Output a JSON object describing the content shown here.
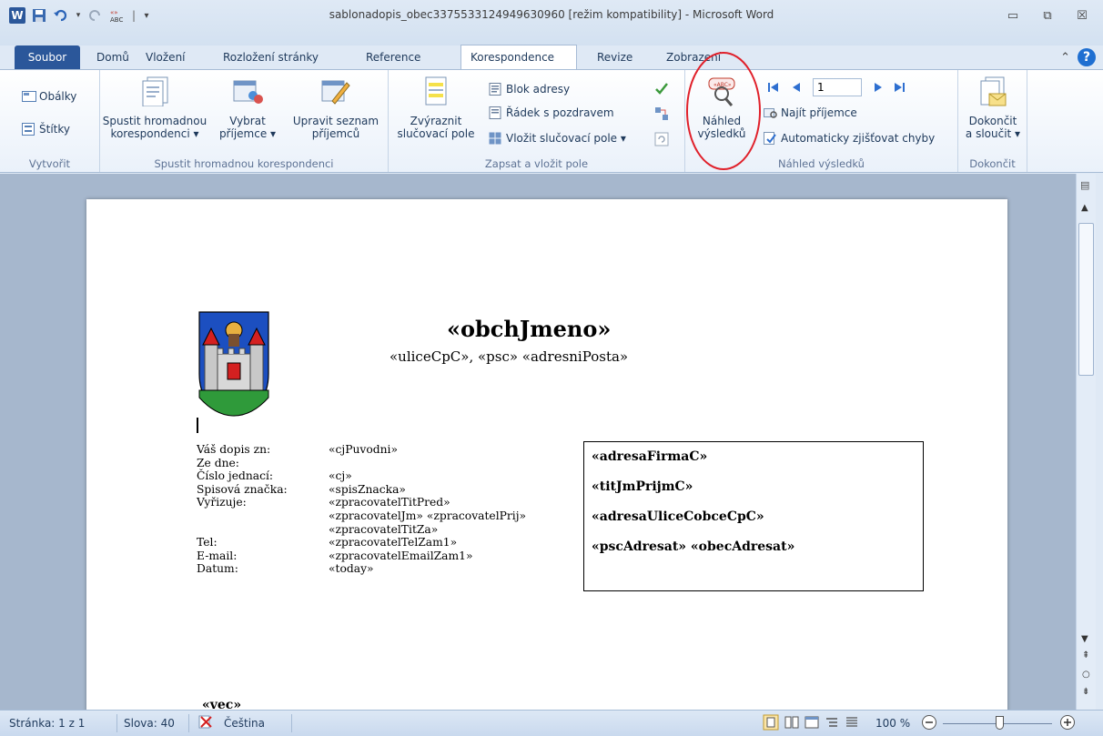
{
  "window": {
    "title": "sablonadopis_obec3375533124949630960 [režim kompatibility] - Microsoft Word"
  },
  "qat": {
    "word_logo": "W",
    "separator": "|"
  },
  "tabs": [
    {
      "label": "Soubor"
    },
    {
      "label": "Domů"
    },
    {
      "label": "Vložení"
    },
    {
      "label": "Rozložení stránky"
    },
    {
      "label": "Reference"
    },
    {
      "label": "Korespondence",
      "active": true
    },
    {
      "label": "Revize"
    },
    {
      "label": "Zobrazení"
    }
  ],
  "ribbon": {
    "create": {
      "label": "Vytvořit",
      "envelopes": "Obálky",
      "labels": "Štítky"
    },
    "start_merge": {
      "label": "Spustit hromadnou korespondenci",
      "start_line1": "Spustit hromadnou",
      "start_line2": "korespondenci ▾",
      "select_line1": "Vybrat",
      "select_line2": "příjemce ▾",
      "edit_line1": "Upravit seznam",
      "edit_line2": "příjemců"
    },
    "write_insert": {
      "label": "Zapsat a vložit pole",
      "highlight_line1": "Zvýraznit",
      "highlight_line2": "slučovací pole",
      "address_block": "Blok adresy",
      "greeting_line": "Řádek s pozdravem",
      "insert_field": "Vložit slučovací pole ▾"
    },
    "preview": {
      "label": "Náhled výsledků",
      "preview_line1": "Náhled",
      "preview_line2": "výsledků",
      "record_number": "1",
      "find_recipient": "Najít příjemce",
      "auto_check": "Automaticky zjišťovat chyby"
    },
    "finish": {
      "label": "Dokončit",
      "finish_line1": "Dokončit",
      "finish_line2": "a sloučit ▾"
    }
  },
  "document": {
    "header_name": "«obchJmeno»",
    "header_address": "«uliceCpC»,  «psc» «adresniPosta»",
    "fields": [
      {
        "label": "Váš dopis zn:",
        "value": "«cjPuvodni»"
      },
      {
        "label": "Ze dne:",
        "value": ""
      },
      {
        "label": "Číslo jednací:",
        "value": "«cj»"
      },
      {
        "label": "Spisová značka:",
        "value": "«spisZnacka»"
      },
      {
        "label": "Vyřizuje:",
        "value": "«zpracovatelTitPred»"
      },
      {
        "label": "",
        "value": "«zpracovatelJm» «zpracovatelPrij»"
      },
      {
        "label": "",
        "value": "«zpracovatelTitZa»"
      },
      {
        "label": "Tel:",
        "value": "«zpracovatelTelZam1»"
      },
      {
        "label": "E-mail:",
        "value": "«zpracovatelEmailZam1»"
      },
      {
        "label": "Datum:",
        "value": "«today»"
      }
    ],
    "address_box": [
      "«adresaFirmaC»",
      "«titJmPrijmC»",
      "«adresaUliceCobceCpC»",
      "«pscAdresat» «obecAdresat»"
    ],
    "subject": "«vec»"
  },
  "status": {
    "page": "Stránka: 1 z 1",
    "words": "Slova: 40",
    "language": "Čeština",
    "zoom": "100 %"
  },
  "colors": {
    "accent": "#2b579a",
    "annotation_circle": "#e0202a"
  }
}
